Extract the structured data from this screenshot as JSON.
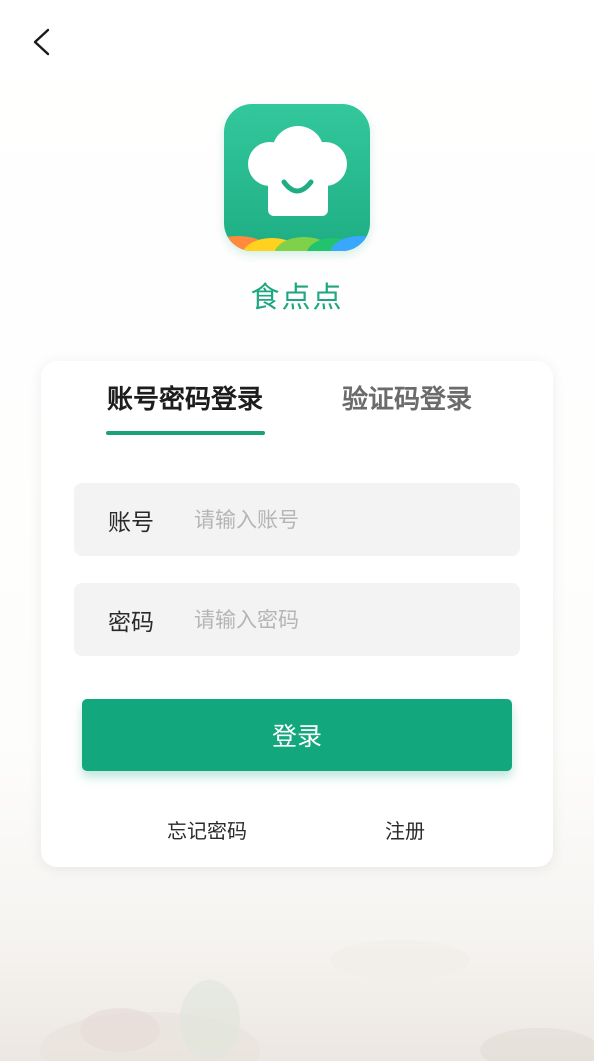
{
  "header": {
    "back_icon": "chevron-left-icon"
  },
  "app": {
    "logo_icon": "chef-hat-icon",
    "name": "食点点",
    "brand_color": "#1aa17a"
  },
  "login_card": {
    "tabs": [
      {
        "label": "账号密码登录",
        "active": true
      },
      {
        "label": "验证码登录",
        "active": false
      }
    ],
    "account": {
      "label": "账号",
      "value": "",
      "placeholder": "请输入账号"
    },
    "password": {
      "label": "密码",
      "value": "",
      "placeholder": "请输入密码"
    },
    "submit_label": "登录",
    "forgot_password_label": "忘记密码",
    "register_label": "注册"
  }
}
